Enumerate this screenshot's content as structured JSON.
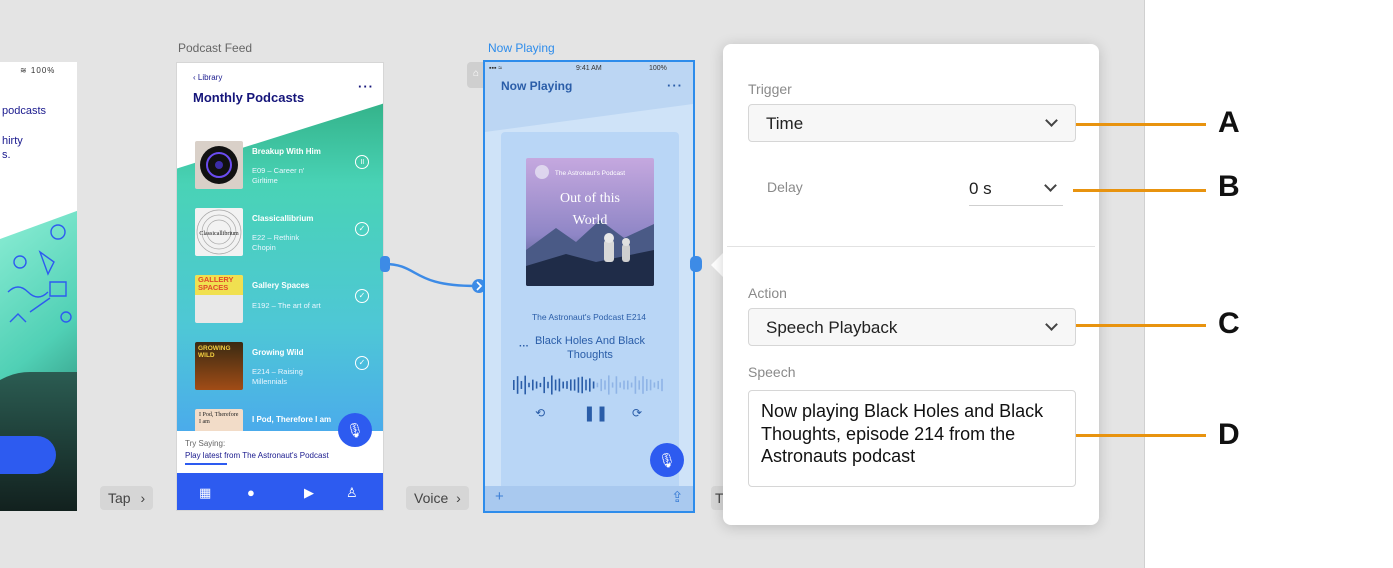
{
  "canvas": {
    "left_artboard": {
      "status": "≋ 100%",
      "line1": "podcasts",
      "line2": "hirty",
      "line3": "s."
    },
    "artboards": [
      {
        "label": "Podcast Feed",
        "back_link": "Library",
        "title": "Monthly Podcasts",
        "more": "···",
        "episodes": [
          {
            "title": "Breakup With Him",
            "subtitle": "E09 – Career n' Girltime"
          },
          {
            "title": "Classicallibrium",
            "subtitle": "E22 – Rethink Chopin"
          },
          {
            "title": "Gallery Spaces",
            "subtitle": "E192 – The art of art"
          },
          {
            "title": "Growing Wild",
            "subtitle": "E214 – Raising Millennials"
          },
          {
            "title": "I Pod, Therefore I am",
            "subtitle": ""
          }
        ],
        "thumbs": [
          "",
          "Classicallibrium",
          "GALLERY SPACES",
          "GROWING WILD",
          "I Pod, Therefore I am"
        ],
        "try_label": "Try Saying:",
        "try_text": "Play latest from The Astronaut's Podcast"
      },
      {
        "label": "Now Playing",
        "time": "9:41 AM",
        "battery": "100%",
        "title": "Now Playing",
        "more": "···",
        "album_header": "The Astronaut's Podcast",
        "album_title": "Out of this World",
        "caption": "The Astronaut's Podcast E214",
        "song": "Black Holes And Black Thoughts"
      }
    ],
    "tags": {
      "tap": "Tap",
      "voice": "Voice",
      "partial": "T"
    }
  },
  "panel": {
    "trigger_label": "Trigger",
    "trigger_value": "Time",
    "delay_label": "Delay",
    "delay_value": "0 s",
    "action_label": "Action",
    "action_value": "Speech Playback",
    "speech_label": "Speech",
    "speech_value": "Now playing Black Holes and Black Thoughts, episode 214 from the Astronauts podcast"
  },
  "callouts": [
    "A",
    "B",
    "C",
    "D"
  ],
  "colors": {
    "accent_blue": "#2d5bf0",
    "selection_blue": "#2d8ceb",
    "callout_orange": "#e8930f"
  }
}
